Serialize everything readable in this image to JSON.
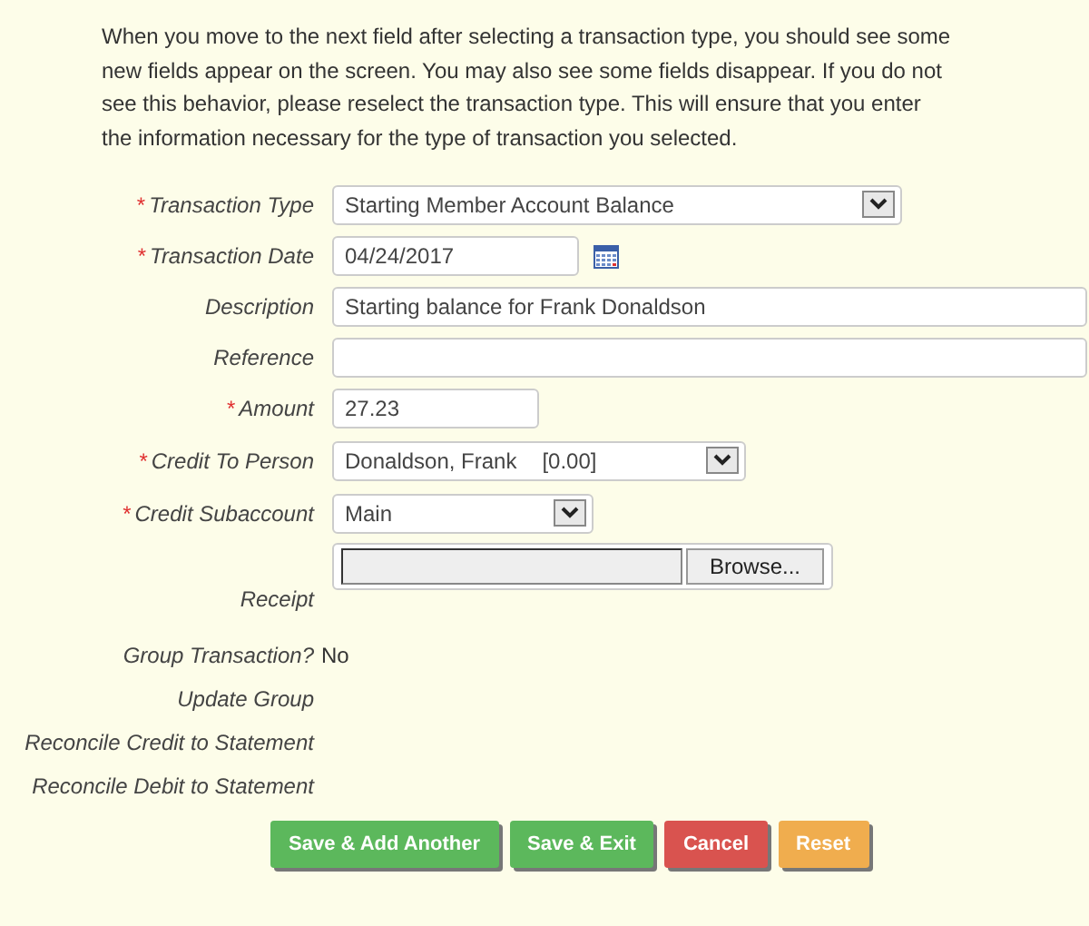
{
  "intro": "When you move to the next field after selecting a transaction type, you should see some new fields appear on the screen. You may also see some fields disappear. If you do not see this behavior, please reselect the transaction type. This will ensure that you enter the information necessary for the type of transaction you selected.",
  "fields": [
    {
      "kind": "select",
      "required_mark": "*",
      "label": "Transaction Type",
      "value": "Starting Member Account Balance"
    },
    {
      "kind": "date",
      "required_mark": "*",
      "label": "Transaction Date",
      "value": "04/24/2017"
    },
    {
      "kind": "text",
      "label": "Description",
      "value": "Starting balance for Frank Donaldson"
    },
    {
      "kind": "text",
      "label": "Reference"
    },
    {
      "kind": "text",
      "required_mark": "*",
      "label": "Amount",
      "value": "27.23"
    },
    {
      "kind": "select",
      "required_mark": "*",
      "label": "Credit To Person",
      "value": "Donaldson, Frank",
      "value_2": "[0.00]"
    },
    {
      "kind": "select",
      "required_mark": "*",
      "label": "Credit Subaccount",
      "value": "Main"
    },
    {
      "kind": "file",
      "label": "Receipt",
      "button": "Browse..."
    },
    {
      "kind": "static",
      "label": "Group Transaction?",
      "value": "No"
    },
    {
      "kind": "static",
      "label": "Update Group"
    },
    {
      "kind": "static",
      "label": "Reconcile Credit to Statement"
    },
    {
      "kind": "static",
      "label": "Reconcile Debit to Statement"
    }
  ],
  "buttons": [
    {
      "label": "Save & Add Another",
      "color": "#5cb85c"
    },
    {
      "label": "Save & Exit",
      "color": "#5cb85c"
    },
    {
      "label": "Cancel",
      "color": "#d9534f"
    },
    {
      "label": "Reset",
      "color": "#f0ad4e"
    }
  ]
}
